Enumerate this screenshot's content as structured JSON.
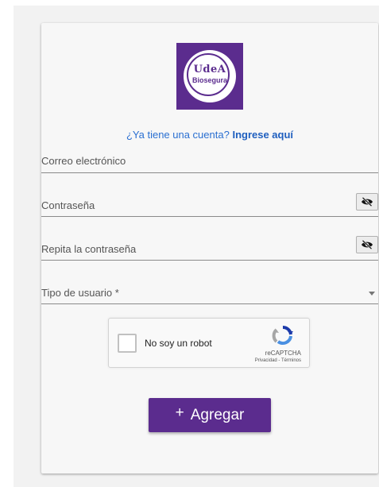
{
  "logo": {
    "line1": "UdeA",
    "line2": "Biosegura",
    "color": "#5b2c8e"
  },
  "login_prompt": {
    "text": "¿Ya tiene una cuenta?",
    "link": "Ingrese aquí"
  },
  "form": {
    "email_label": "Correo electrónico",
    "password_label": "Contraseña",
    "password_toggle_icon": "eye-slash-icon",
    "repeat_password_label": "Repita la contraseña",
    "user_type_label": "Tipo de usuario *",
    "user_type_icon": "caret-down-icon"
  },
  "captcha": {
    "checkbox_label": "No soy un robot",
    "brand": "reCAPTCHA",
    "links": "Privacidad - Términos"
  },
  "submit": {
    "icon": "+",
    "label": "Agregar",
    "color": "#5b2c8e"
  }
}
